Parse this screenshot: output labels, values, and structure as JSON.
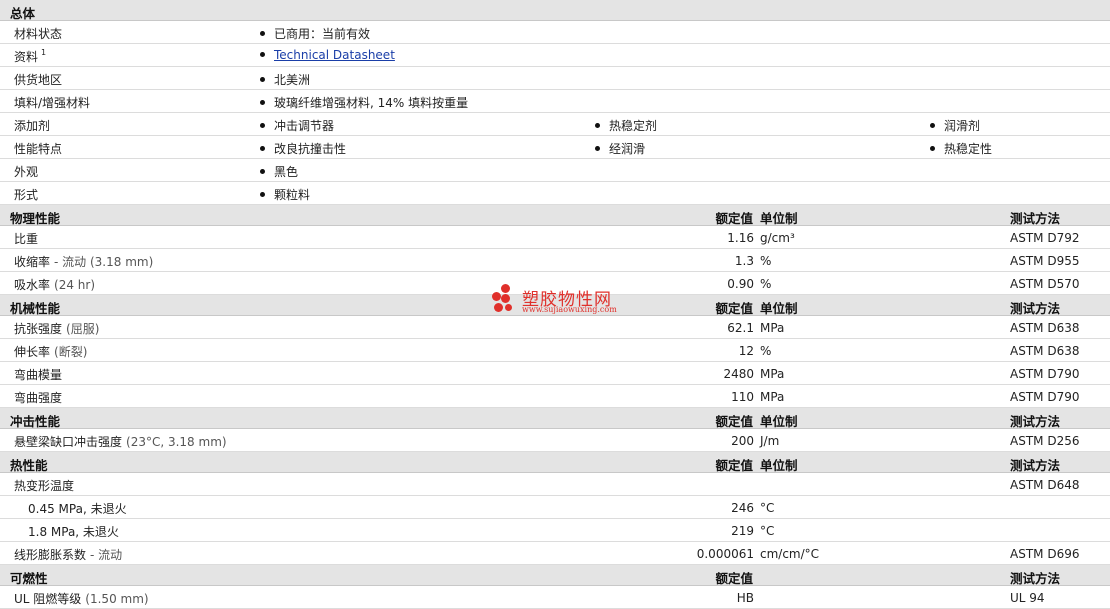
{
  "general": {
    "title": "总体",
    "rows": [
      {
        "label": "材料状态",
        "items": [
          "已商用：当前有效"
        ]
      },
      {
        "label": "资料",
        "sup": "1",
        "link": "Technical Datasheet"
      },
      {
        "label": "供货地区",
        "items": [
          "北美洲"
        ]
      },
      {
        "label": "填料/增强材料",
        "items": [
          "玻璃纤维增强材料, 14% 填料按重量"
        ]
      },
      {
        "label": "添加剂",
        "items": [
          "冲击调节器",
          "热稳定剂",
          "润滑剂"
        ]
      },
      {
        "label": "性能特点",
        "items": [
          "改良抗撞击性",
          "经润滑",
          "热稳定性"
        ]
      },
      {
        "label": "外观",
        "items": [
          "黑色"
        ]
      },
      {
        "label": "形式",
        "items": [
          "颗粒料"
        ]
      }
    ]
  },
  "columns": {
    "nominal": "额定值",
    "unit": "单位制",
    "method": "测试方法"
  },
  "physical": {
    "title": "物理性能",
    "rows": [
      {
        "label": "比重",
        "cond": "",
        "value": "1.16",
        "unit": "g/cm³",
        "method": "ASTM D792"
      },
      {
        "label": "收缩率",
        "cond": "- 流动 (3.18 mm)",
        "value": "1.3",
        "unit": "%",
        "method": "ASTM D955"
      },
      {
        "label": "吸水率",
        "cond": "(24 hr)",
        "value": "0.90",
        "unit": "%",
        "method": "ASTM D570"
      }
    ]
  },
  "mechanical": {
    "title": "机械性能",
    "rows": [
      {
        "label": "抗张强度",
        "cond": "(屈服)",
        "value": "62.1",
        "unit": "MPa",
        "method": "ASTM D638"
      },
      {
        "label": "伸长率",
        "cond": "(断裂)",
        "value": "12",
        "unit": "%",
        "method": "ASTM D638"
      },
      {
        "label": "弯曲模量",
        "cond": "",
        "value": "2480",
        "unit": "MPa",
        "method": "ASTM D790"
      },
      {
        "label": "弯曲强度",
        "cond": "",
        "value": "110",
        "unit": "MPa",
        "method": "ASTM D790"
      }
    ]
  },
  "impact": {
    "title": "冲击性能",
    "rows": [
      {
        "label": "悬壁梁缺口冲击强度",
        "cond": "(23°C, 3.18 mm)",
        "value": "200",
        "unit": "J/m",
        "method": "ASTM D256"
      }
    ]
  },
  "thermal": {
    "title": "热性能",
    "rows": [
      {
        "label": "热变形温度",
        "cond": "",
        "value": "",
        "unit": "",
        "method": "ASTM D648"
      },
      {
        "label": "0.45 MPa, 未退火",
        "cond": "",
        "value": "246",
        "unit": "°C",
        "method": "",
        "indent": true
      },
      {
        "label": "1.8 MPa, 未退火",
        "cond": "",
        "value": "219",
        "unit": "°C",
        "method": "",
        "indent": true
      },
      {
        "label": "线形膨胀系数",
        "cond": "- 流动",
        "value": "0.000061",
        "unit": "cm/cm/°C",
        "method": "ASTM D696"
      }
    ]
  },
  "flammability": {
    "title": "可燃性",
    "rows": [
      {
        "label": "UL 阻燃等级",
        "cond": "(1.50 mm)",
        "value": "HB",
        "unit": "",
        "method": "UL 94"
      }
    ]
  },
  "watermark": {
    "title": "塑胶物性网",
    "url": "www.sujiaowuxing.com",
    "color": "#e0302b"
  }
}
